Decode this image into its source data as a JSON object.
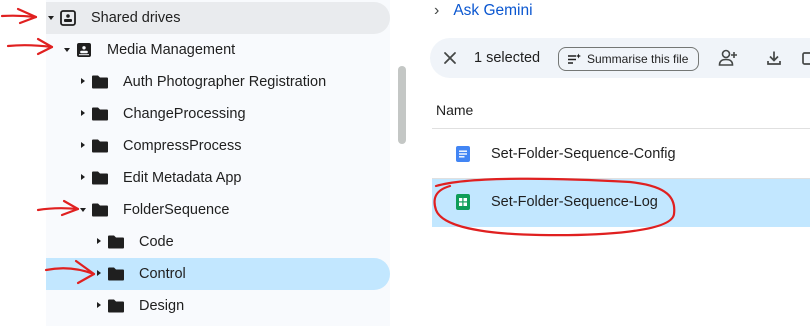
{
  "sidebar": {
    "shared_drives": {
      "label": "Shared drives",
      "icon": "shared-drives-icon"
    },
    "items": [
      {
        "label": "Media Management",
        "icon": "shared-drive-icon"
      },
      {
        "label": "Auth Photographer Registration",
        "icon": "folder-icon"
      },
      {
        "label": "ChangeProcessing",
        "icon": "folder-icon"
      },
      {
        "label": "CompressProcess",
        "icon": "folder-icon"
      },
      {
        "label": "Edit Metadata App",
        "icon": "folder-icon"
      },
      {
        "label": "FolderSequence",
        "icon": "folder-icon"
      },
      {
        "label": "Code",
        "icon": "folder-icon"
      },
      {
        "label": "Control",
        "icon": "folder-icon"
      },
      {
        "label": "Design",
        "icon": "folder-icon"
      }
    ]
  },
  "header": {
    "ask_gemini": "Ask Gemini"
  },
  "toolbar": {
    "selected_text": "1 selected",
    "summarise_label": "Summarise this file"
  },
  "list": {
    "column_name": "Name",
    "files": [
      {
        "name": "Set-Folder-Sequence-Config",
        "type": "docs",
        "icon": "google-docs-icon"
      },
      {
        "name": "Set-Folder-Sequence-Log",
        "type": "sheets",
        "icon": "google-sheets-icon",
        "selected": true
      }
    ]
  },
  "colors": {
    "selection": "#c2e7ff",
    "accent_blue": "#0b57d0",
    "annotation_red": "#e02020",
    "docs_blue": "#4285f4",
    "sheets_green": "#0f9d58"
  }
}
